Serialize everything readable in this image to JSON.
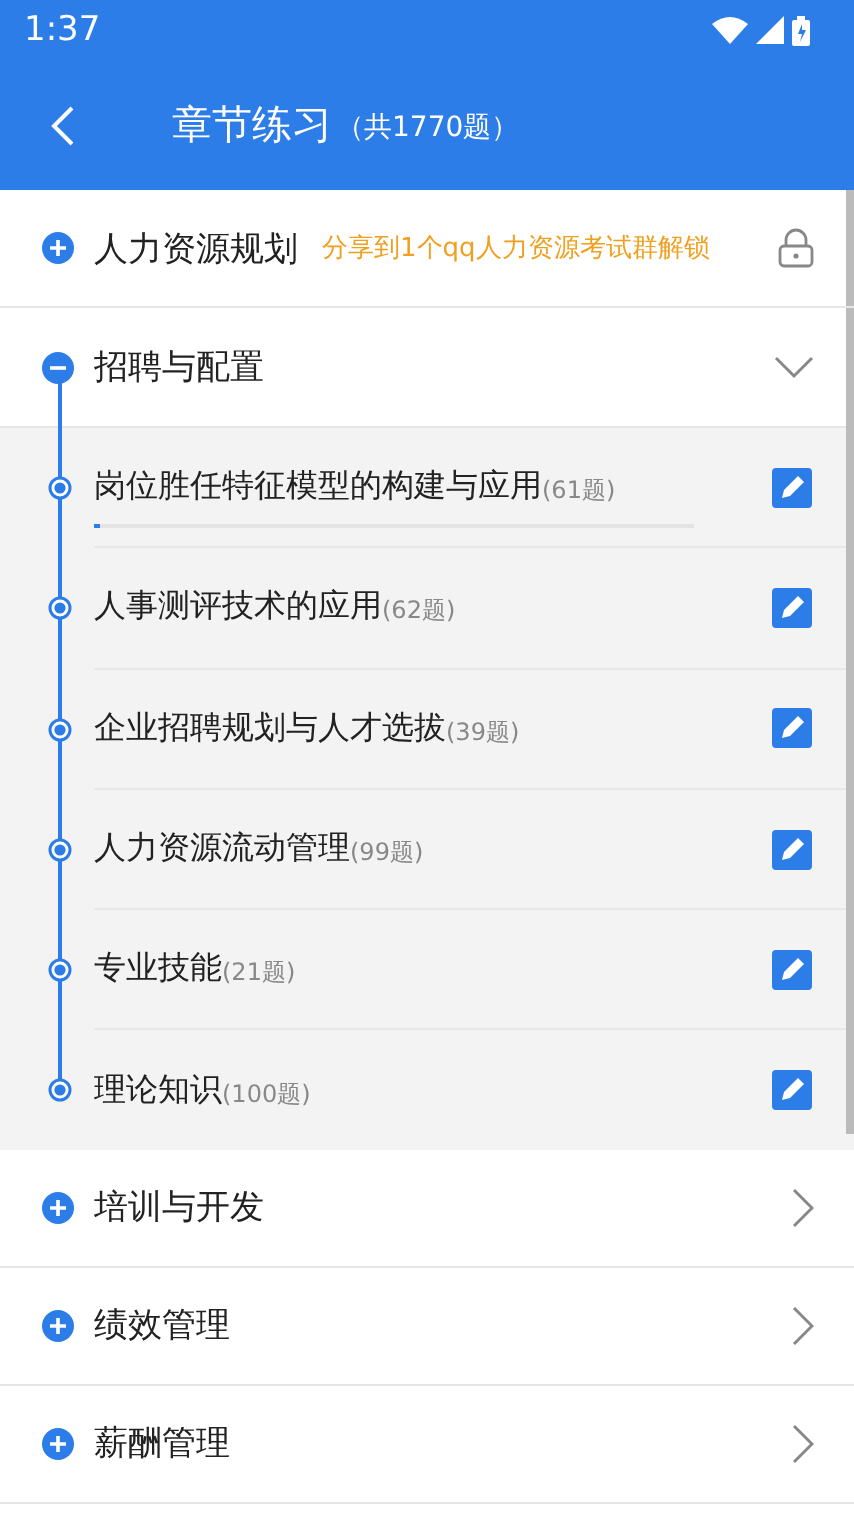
{
  "status_bar": {
    "time": "1:37"
  },
  "app_bar": {
    "title": "章节练习",
    "subtitle": "（共1770题）"
  },
  "chapters": [
    {
      "title": "人力资源规划",
      "expanded": false,
      "locked": true,
      "hint": "分享到1个qq人力资源考试群解锁"
    },
    {
      "title": "招聘与配置",
      "expanded": true,
      "locked": false,
      "sections": [
        {
          "title": "岗位胜任特征模型的构建与应用",
          "count": "(61题)",
          "level": 0.01
        },
        {
          "title": "人事测评技术的应用",
          "count": "(62题)"
        },
        {
          "title": "企业招聘规划与人才选拔",
          "count": "(39题)"
        },
        {
          "title": "人力资源流动管理",
          "count": "(99题)"
        },
        {
          "title": "专业技能",
          "count": "(21题)"
        },
        {
          "title": "理论知识",
          "count": "(100题)"
        }
      ]
    },
    {
      "title": "培训与开发",
      "expanded": false,
      "locked": false
    },
    {
      "title": "绩效管理",
      "expanded": false,
      "locked": false
    },
    {
      "title": "薪酬管理",
      "expanded": false,
      "locked": false
    }
  ]
}
